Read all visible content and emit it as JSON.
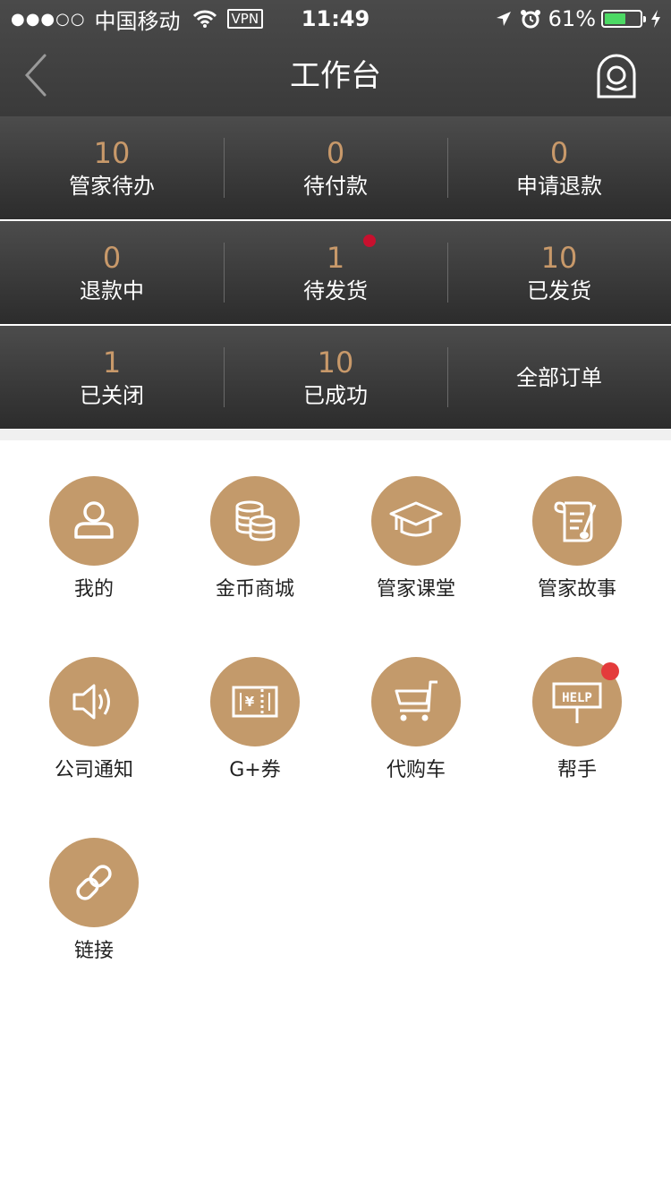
{
  "status_bar": {
    "signal": "●●●○○",
    "carrier": "中国移动",
    "vpn": "VPN",
    "time": "11:49",
    "battery_text": "61%",
    "battery_level": 0.61
  },
  "nav": {
    "title": "工作台",
    "back_icon": "chevron-left-icon",
    "profile_icon": "profile-avatar-icon"
  },
  "stats": [
    [
      {
        "num": "10",
        "label": "管家待办"
      },
      {
        "num": "0",
        "label": "待付款"
      },
      {
        "num": "0",
        "label": "申请退款"
      }
    ],
    [
      {
        "num": "0",
        "label": "退款中"
      },
      {
        "num": "1",
        "label": "待发货",
        "badge": true
      },
      {
        "num": "10",
        "label": "已发货"
      }
    ],
    [
      {
        "num": "1",
        "label": "已关闭"
      },
      {
        "num": "10",
        "label": "已成功"
      },
      {
        "label": "全部订单"
      }
    ]
  ],
  "menu": [
    {
      "label": "我的",
      "icon": "user-icon"
    },
    {
      "label": "金币商城",
      "icon": "coins-icon"
    },
    {
      "label": "管家课堂",
      "icon": "graduation-cap-icon"
    },
    {
      "label": "管家故事",
      "icon": "scroll-quill-icon"
    },
    {
      "label": "公司通知",
      "icon": "speaker-icon"
    },
    {
      "label": "G+券",
      "icon": "ticket-icon"
    },
    {
      "label": "代购车",
      "icon": "cart-icon"
    },
    {
      "label": "帮手",
      "icon": "help-sign-icon",
      "badge": true
    },
    {
      "label": "链接",
      "icon": "link-icon"
    }
  ],
  "colors": {
    "accent": "#c39a6b",
    "number": "#c8996a",
    "header": "#3a3a3a",
    "badge": "#e43b3b",
    "battery": "#4cd964"
  }
}
